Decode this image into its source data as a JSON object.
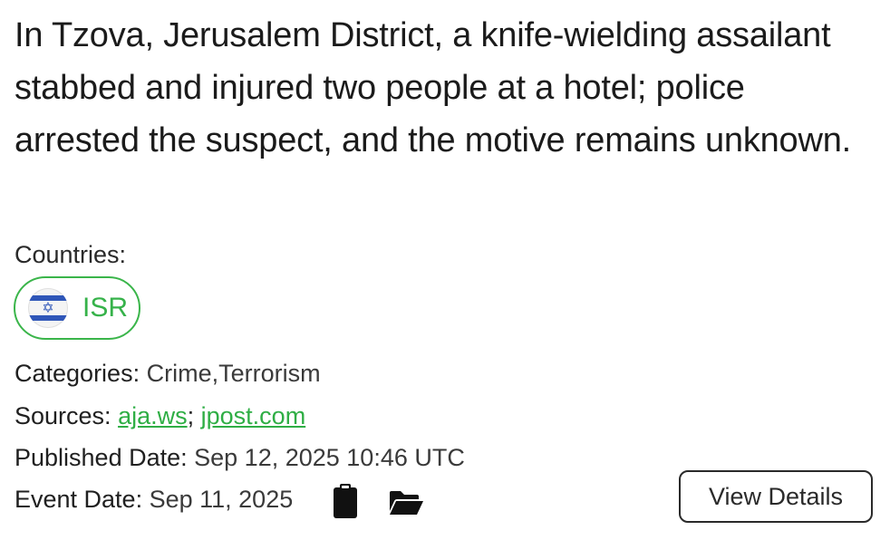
{
  "headline": "In Tzova, Jerusalem District, a knife-wielding assailant stabbed and injured two people at a hotel; police arrested the suspect, and the motive remains unknown.",
  "countries": {
    "label": "Countries:",
    "items": [
      {
        "code": "ISR",
        "icon": "israel-flag-icon"
      }
    ]
  },
  "categories": {
    "label": "Categories:",
    "value": "Crime,Terrorism"
  },
  "sources": {
    "label": "Sources:",
    "links": [
      "aja.ws",
      "jpost.com"
    ],
    "separator": ";"
  },
  "published_date": {
    "label": "Published Date:",
    "value": "Sep 12, 2025 10:46 UTC"
  },
  "event_date": {
    "label": "Event Date:",
    "value": "Sep 11, 2025"
  },
  "actions": {
    "view_details_label": "View Details",
    "icons": [
      "clipboard-icon",
      "folder-open-icon"
    ]
  },
  "colors": {
    "accent": "#36b24a",
    "text": "#1b1b1b",
    "flag_blue": "#2f56b8"
  }
}
